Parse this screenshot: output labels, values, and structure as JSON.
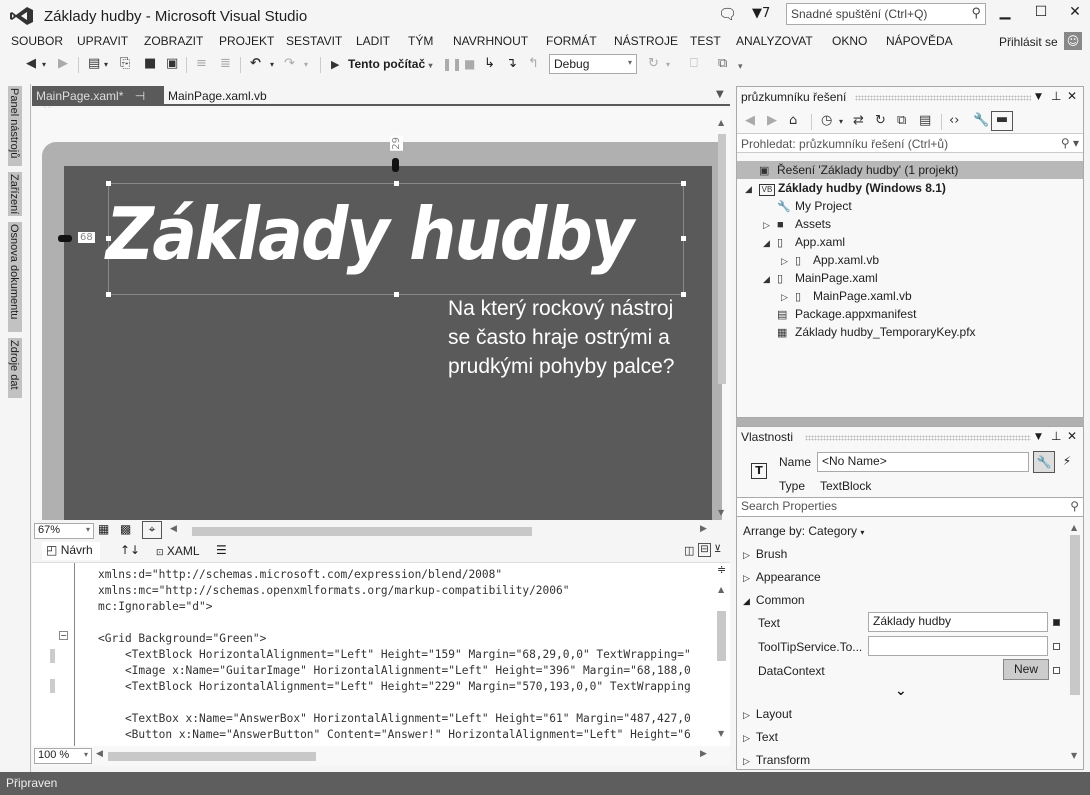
{
  "window": {
    "title": "Základy hudby - Microsoft Visual Studio",
    "notifications_icon": "speech-bubble-icon",
    "filter_count": "7",
    "quick_launch_placeholder": "Snadné spuštění (Ctrl+Q)",
    "sign_in": "Přihlásit se"
  },
  "menu": [
    "SOUBOR",
    "UPRAVIT",
    "ZOBRAZIT",
    "PROJEKT",
    "SESTAVIT",
    "LADIT",
    "TÝM",
    "NAVRHNOUT",
    "FORMÁT",
    "NÁSTROJE",
    "TEST",
    "ANALYZOVAT",
    "OKNO",
    "NÁPOVĚDA"
  ],
  "toolbar": {
    "run_target": "Tento počítač",
    "configuration": "Debug"
  },
  "side_tabs": [
    "Panel nástrojů",
    "Zařízení",
    "Osnova dokumentu",
    "Zdroje dat"
  ],
  "doc_tabs": [
    {
      "label": "MainPage.xaml*",
      "active": true
    },
    {
      "label": "MainPage.xaml.vb",
      "active": false
    }
  ],
  "designer": {
    "heading": "Základy hudby",
    "question": "Na který rockový nástroj se často hraje ostrými a prudkými pohyby palce?",
    "margin_top": "29",
    "margin_left": "68",
    "zoom": "67%",
    "canvas_color": "#5a5a5a"
  },
  "split_tabs": {
    "design": "Návrh",
    "swap": "↑↓",
    "xaml": "XAML"
  },
  "code": {
    "lines": [
      "xmlns:d=\"http://schemas.microsoft.com/expression/blend/2008\"",
      "xmlns:mc=\"http://schemas.openxmlformats.org/markup-compatibility/2006\"",
      "mc:Ignorable=\"d\">",
      "",
      "<Grid Background=\"Green\">",
      "    <TextBlock HorizontalAlignment=\"Left\" Height=\"159\" Margin=\"68,29,0,0\" TextWrapping=\"",
      "    <Image x:Name=\"GuitarImage\" HorizontalAlignment=\"Left\" Height=\"396\" Margin=\"68,188,0",
      "    <TextBlock HorizontalAlignment=\"Left\" Height=\"229\" Margin=\"570,193,0,0\" TextWrapping",
      "",
      "    <TextBox x:Name=\"AnswerBox\" HorizontalAlignment=\"Left\" Height=\"61\" Margin=\"487,427,0",
      "    <Button x:Name=\"AnswerButton\" Content=\"Answer!\" HorizontalAlignment=\"Left\" Height=\"6"
    ],
    "zoom": "100 %"
  },
  "status": "Připraven",
  "solution_explorer": {
    "title": "průzkumníku řešení",
    "search_placeholder": "Prohledat: průzkumníku řešení (Ctrl+ů)",
    "tree": [
      {
        "label": "Řešení 'Základy hudby' (1 projekt)",
        "level": 0,
        "expander": "",
        "icon": "solution-icon",
        "glyph": "▣",
        "bold": false,
        "selected": true
      },
      {
        "label": "Základy hudby (Windows 8.1)",
        "level": 0,
        "expander": "◢",
        "icon": "vb-project-icon",
        "glyph": "VB",
        "bold": true
      },
      {
        "label": "My Project",
        "level": 1,
        "expander": "",
        "icon": "wrench-icon",
        "glyph": "🔧"
      },
      {
        "label": "Assets",
        "level": 1,
        "expander": "▷",
        "icon": "folder-icon",
        "glyph": "■"
      },
      {
        "label": "App.xaml",
        "level": 1,
        "expander": "◢",
        "icon": "xaml-file-icon",
        "glyph": "▯"
      },
      {
        "label": "App.xaml.vb",
        "level": 2,
        "expander": "▷",
        "icon": "vb-file-icon",
        "glyph": "▯"
      },
      {
        "label": "MainPage.xaml",
        "level": 1,
        "expander": "◢",
        "icon": "xaml-file-icon",
        "glyph": "▯"
      },
      {
        "label": "MainPage.xaml.vb",
        "level": 2,
        "expander": "▷",
        "icon": "vb-file-icon",
        "glyph": "▯"
      },
      {
        "label": "Package.appxmanifest",
        "level": 1,
        "expander": "",
        "icon": "manifest-icon",
        "glyph": "▤"
      },
      {
        "label": "Základy hudby_TemporaryKey.pfx",
        "level": 1,
        "expander": "",
        "icon": "certificate-icon",
        "glyph": "▦"
      }
    ]
  },
  "properties": {
    "title": "Vlastnosti",
    "name_label": "Name",
    "name_value": "<No Name>",
    "type_label": "Type",
    "type_value": "TextBlock",
    "search_placeholder": "Search Properties",
    "arrange_by": "Arrange by: Category",
    "categories_before": [
      {
        "label": "Brush",
        "expanded": false
      },
      {
        "label": "Appearance",
        "expanded": false
      },
      {
        "label": "Common",
        "expanded": true
      }
    ],
    "common": {
      "text_label": "Text",
      "text_value": "Základy hudby",
      "tooltip_label": "ToolTipService.To...",
      "tooltip_value": "",
      "datacontext_label": "DataContext",
      "new_button": "New"
    },
    "categories_after": [
      {
        "label": "Layout",
        "expanded": false
      },
      {
        "label": "Text",
        "expanded": false
      },
      {
        "label": "Transform",
        "expanded": false
      }
    ]
  }
}
